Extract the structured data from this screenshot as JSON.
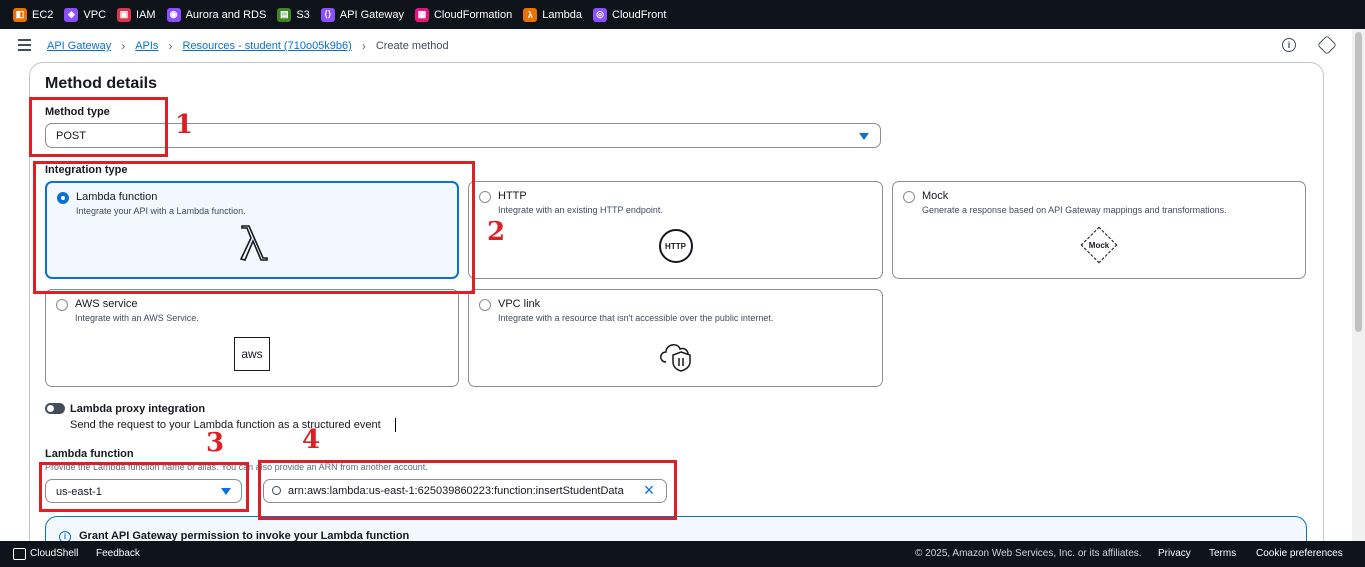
{
  "services": [
    {
      "name": "EC2",
      "color": "#ed7100",
      "icon": "ec2-icon"
    },
    {
      "name": "VPC",
      "color": "#8c4fff",
      "icon": "vpc-icon"
    },
    {
      "name": "IAM",
      "color": "#dd344c",
      "icon": "iam-icon"
    },
    {
      "name": "Aurora and RDS",
      "color": "#8c4fff",
      "icon": "rds-icon"
    },
    {
      "name": "S3",
      "color": "#3f8624",
      "icon": "s3-icon"
    },
    {
      "name": "API Gateway",
      "color": "#8c4fff",
      "icon": "api-gateway-icon"
    },
    {
      "name": "CloudFormation",
      "color": "#e7157b",
      "icon": "cloudformation-icon"
    },
    {
      "name": "Lambda",
      "color": "#ed7100",
      "icon": "lambda-icon"
    },
    {
      "name": "CloudFront",
      "color": "#8c4fff",
      "icon": "cloudfront-icon"
    }
  ],
  "breadcrumb": {
    "api_gateway": "API Gateway",
    "apis": "APIs",
    "resources": "Resources - student (710o05k9b6)",
    "current": "Create method"
  },
  "form": {
    "title": "Method details",
    "method_type_label": "Method type",
    "method_type_value": "POST",
    "integration_type_label": "Integration type",
    "tiles": [
      {
        "title": "Lambda function",
        "desc": "Integrate your API with a Lambda function.",
        "selected": true,
        "icon": "lambda-icon"
      },
      {
        "title": "HTTP",
        "desc": "Integrate with an existing HTTP endpoint.",
        "selected": false,
        "icon": "http-icon",
        "icon_text": "HTTP"
      },
      {
        "title": "Mock",
        "desc": "Generate a response based on API Gateway mappings and transformations.",
        "selected": false,
        "icon": "mock-icon",
        "icon_text": "Mock"
      },
      {
        "title": "AWS service",
        "desc": "Integrate with an AWS Service.",
        "selected": false,
        "icon": "aws-icon",
        "icon_text": "aws"
      },
      {
        "title": "VPC link",
        "desc": "Integrate with a resource that isn't accessible over the public internet.",
        "selected": false,
        "icon": "vpc-link-icon"
      }
    ],
    "proxy_label": "Lambda proxy integration",
    "proxy_desc": "Send the request to your Lambda function as a structured event",
    "lambda_label": "Lambda function",
    "lambda_desc": "Provide the Lambda function name or alias. You can also provide an ARN from another account.",
    "region_value": "us-east-1",
    "arn_value": "arn:aws:lambda:us-east-1:625039860223:function:insertStudentData",
    "alert_title": "Grant API Gateway permission to invoke your Lambda function"
  },
  "annotations": [
    "1",
    "2",
    "3",
    "4"
  ],
  "footer": {
    "cloudshell": "CloudShell",
    "feedback": "Feedback",
    "copyright": "© 2025, Amazon Web Services, Inc. or its affiliates.",
    "privacy": "Privacy",
    "terms": "Terms",
    "cookies": "Cookie preferences"
  },
  "colors": {
    "accent": "#0972d3",
    "annotation": "#dd1f26",
    "topbar": "#0f141a"
  }
}
